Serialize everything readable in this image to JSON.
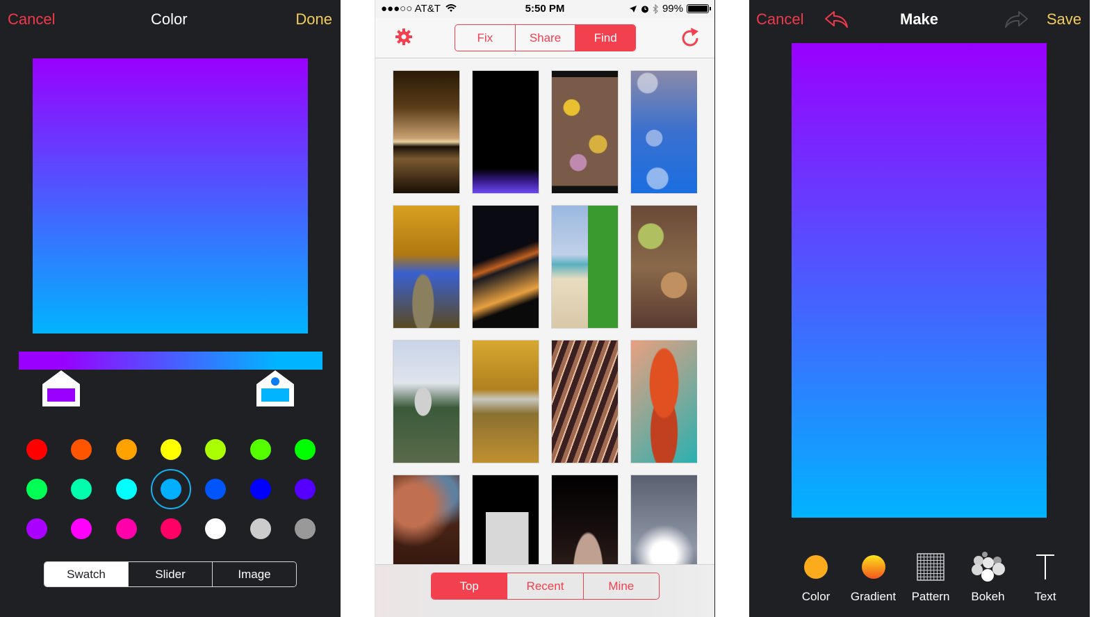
{
  "color_screen": {
    "nav": {
      "cancel": "Cancel",
      "title": "Color",
      "done": "Done"
    },
    "colors": {
      "gradient_start": "#9900ff",
      "gradient_end": "#00b4ff",
      "accent_red": "#f0394a",
      "accent_gold": "#f3cb5a",
      "background": "#1f2024"
    },
    "gradient_stops": [
      {
        "name": "start",
        "color": "#9900ff",
        "position": 0.14,
        "selected": false
      },
      {
        "name": "end",
        "color": "#00b4ff",
        "position": 0.85,
        "selected": true
      }
    ],
    "swatches": [
      [
        "#ff0000",
        "#ff5500",
        "#ffa200",
        "#ffff00",
        "#aaff00",
        "#55ff00",
        "#00ff00"
      ],
      [
        "#00ff55",
        "#00ffaa",
        "#00ffff",
        "#00b0ff",
        "#0055ff",
        "#0000ff",
        "#5500ff"
      ],
      [
        "#aa00ff",
        "#ff00ff",
        "#ff00aa",
        "#ff0066",
        "#ffffff",
        "#cccccc",
        "#999999"
      ]
    ],
    "selected_swatch": "#00b0ff",
    "modes": [
      {
        "label": "Swatch",
        "active": true
      },
      {
        "label": "Slider",
        "active": false
      },
      {
        "label": "Image",
        "active": false
      }
    ]
  },
  "find_screen": {
    "status": {
      "carrier": "●●●○○ AT&T",
      "time": "5:50 PM",
      "battery": "99%",
      "battery_level": 0.99
    },
    "tabs": [
      {
        "label": "Fix",
        "active": false
      },
      {
        "label": "Share",
        "active": false
      },
      {
        "label": "Find",
        "active": true
      }
    ],
    "icons": {
      "settings": "gear-icon",
      "refresh": "refresh-icon"
    },
    "accent": "#f2404f",
    "thumbnails": [
      {
        "name": "sepia-sunset-lake"
      },
      {
        "name": "black-purple-horizon"
      },
      {
        "name": "autumn-leaves-pile"
      },
      {
        "name": "blue-bokeh"
      },
      {
        "name": "autumn-tree-upward"
      },
      {
        "name": "golden-gate-night"
      },
      {
        "name": "beach-green-hut"
      },
      {
        "name": "fallen-leaves-closeup"
      },
      {
        "name": "statue-garden"
      },
      {
        "name": "yellow-forest"
      },
      {
        "name": "copper-tunnel"
      },
      {
        "name": "red-tree-reflection"
      },
      {
        "name": "nebula-space"
      },
      {
        "name": "family-portrait-bw"
      },
      {
        "name": "woman-portrait"
      },
      {
        "name": "palm-cloudy-sky"
      }
    ],
    "filters": [
      {
        "label": "Top",
        "active": true
      },
      {
        "label": "Recent",
        "active": false
      },
      {
        "label": "Mine",
        "active": false
      }
    ]
  },
  "make_screen": {
    "nav": {
      "cancel": "Cancel",
      "title": "Make",
      "save": "Save",
      "undo_enabled": true,
      "redo_enabled": false
    },
    "tools": [
      {
        "label": "Color",
        "icon": "color-icon"
      },
      {
        "label": "Gradient",
        "icon": "gradient-icon"
      },
      {
        "label": "Pattern",
        "icon": "pattern-icon"
      },
      {
        "label": "Bokeh",
        "icon": "bokeh-icon"
      },
      {
        "label": "Text",
        "icon": "text-icon"
      }
    ]
  }
}
